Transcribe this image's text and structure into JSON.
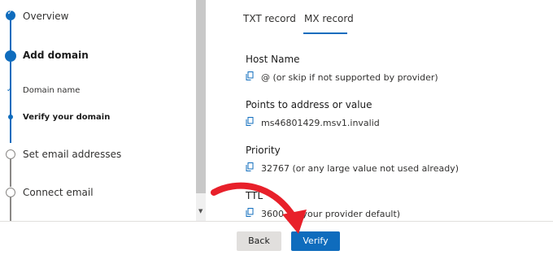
{
  "wizard": {
    "steps": [
      {
        "label": "Overview",
        "state": "done"
      },
      {
        "label": "Add domain",
        "state": "current"
      },
      {
        "label": "Domain name",
        "state": "done-sub"
      },
      {
        "label": "Verify your domain",
        "state": "current-sub"
      },
      {
        "label": "Set email addresses",
        "state": "todo"
      },
      {
        "label": "Connect email",
        "state": "todo"
      }
    ]
  },
  "tabs": [
    {
      "label": "TXT record",
      "selected": false
    },
    {
      "label": "MX record",
      "selected": true
    }
  ],
  "fields": [
    {
      "label": "Host Name",
      "value": "@ (or skip if not supported by provider)"
    },
    {
      "label": "Points to address or value",
      "value": "ms46801429.msv1.invalid"
    },
    {
      "label": "Priority",
      "value": "32767 (or any large value not used already)"
    },
    {
      "label": "TTL",
      "value": "3600 (or your provider default)"
    }
  ],
  "footer": {
    "back_label": "Back",
    "verify_label": "Verify"
  },
  "colors": {
    "accent": "#0f6cbd",
    "annotation": "#e8202a"
  },
  "icons": [
    "checkmark-icon",
    "copy-icon",
    "scroll-down-arrow-icon",
    "red-arrow-annotation-icon"
  ]
}
